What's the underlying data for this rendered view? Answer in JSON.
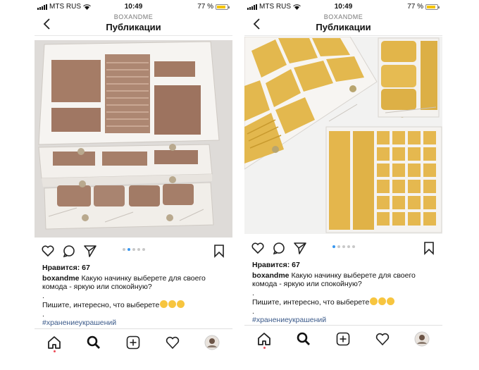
{
  "left": {
    "status": {
      "carrier": "MTS RUS",
      "time": "10:49",
      "battery": "77 %",
      "battery_level": 0.77
    },
    "header": {
      "username": "BOXANDME",
      "title": "Публикации"
    },
    "carousel": {
      "total": 5,
      "active": 2
    },
    "post": {
      "likes": "Нравится: 67",
      "username": "boxandme",
      "caption": "Какую начинку выберете для своего комода - яркую или спокойную?",
      "dot1": ".",
      "line2": "Пишите, интересно, что выберете",
      "dot2": ".",
      "hashtag": "#хранениеукрашений"
    }
  },
  "right": {
    "status": {
      "carrier": "MTS RUS",
      "time": "10:49",
      "battery": "77 %",
      "battery_level": 0.77
    },
    "header": {
      "username": "BOXANDME",
      "title": "Публикации"
    },
    "carousel": {
      "total": 5,
      "active": 1
    },
    "post": {
      "likes": "Нравится: 67",
      "username": "boxandme",
      "caption": "Какую начинку выберете для своего комода - яркую или спокойную?",
      "dot1": ".",
      "line2": "Пишите, интересно, что выберете",
      "dot2": ".",
      "hashtag": "#хранениеукрашений"
    }
  },
  "icons": {
    "back": "chevron-left-icon",
    "like": "heart-icon",
    "comment": "comment-icon",
    "share": "send-icon",
    "save": "bookmark-icon",
    "home": "home-icon",
    "search": "search-icon",
    "add": "plus-square-icon",
    "activity": "heart-outline-icon",
    "profile": "avatar-icon"
  },
  "colors": {
    "link": "#3b5a8a",
    "carousel_active": "#3897f0",
    "battery": "#f4c400",
    "velvet_brown": "#a07c66",
    "velvet_yellow": "#e0b64a"
  }
}
